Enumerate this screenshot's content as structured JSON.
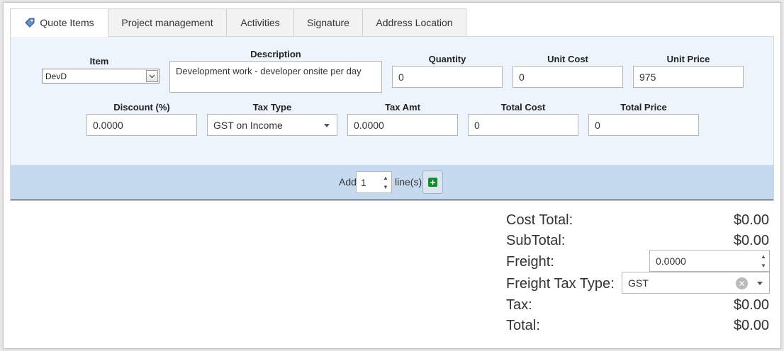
{
  "tabs": [
    {
      "label": "Quote Items",
      "icon": "price-tag-icon",
      "active": true
    },
    {
      "label": "Project management"
    },
    {
      "label": "Activities"
    },
    {
      "label": "Signature"
    },
    {
      "label": "Address Location"
    }
  ],
  "form": {
    "item": {
      "label": "Item",
      "value": "DevD"
    },
    "description": {
      "label": "Description",
      "value": "Development work - developer onsite per day"
    },
    "quantity": {
      "label": "Quantity",
      "value": "0"
    },
    "unit_cost": {
      "label": "Unit Cost",
      "value": "0"
    },
    "unit_price": {
      "label": "Unit Price",
      "value": "975"
    },
    "discount": {
      "label": "Discount (%)",
      "value": "0.0000"
    },
    "tax_type": {
      "label": "Tax Type",
      "value": "GST on Income"
    },
    "tax_amt": {
      "label": "Tax Amt",
      "value": "0.0000"
    },
    "total_cost": {
      "label": "Total Cost",
      "value": "0"
    },
    "total_price": {
      "label": "Total Price",
      "value": "0"
    }
  },
  "add_lines": {
    "prefix": "Add",
    "count": "1",
    "suffix": "line(s)"
  },
  "totals": {
    "cost_total": {
      "label": "Cost Total:",
      "value": "$0.00"
    },
    "subtotal": {
      "label": "SubTotal:",
      "value": "$0.00"
    },
    "freight": {
      "label": "Freight:",
      "value": "0.0000"
    },
    "freight_tax_type": {
      "label": "Freight Tax Type:",
      "value": "GST"
    },
    "tax": {
      "label": "Tax:",
      "value": "$0.00"
    },
    "total": {
      "label": "Total:",
      "value": "$0.00"
    }
  },
  "colors": {
    "panel": "#eef4fc",
    "add_bar": "#c5d9ef",
    "add_button": "#1a8a2e"
  }
}
